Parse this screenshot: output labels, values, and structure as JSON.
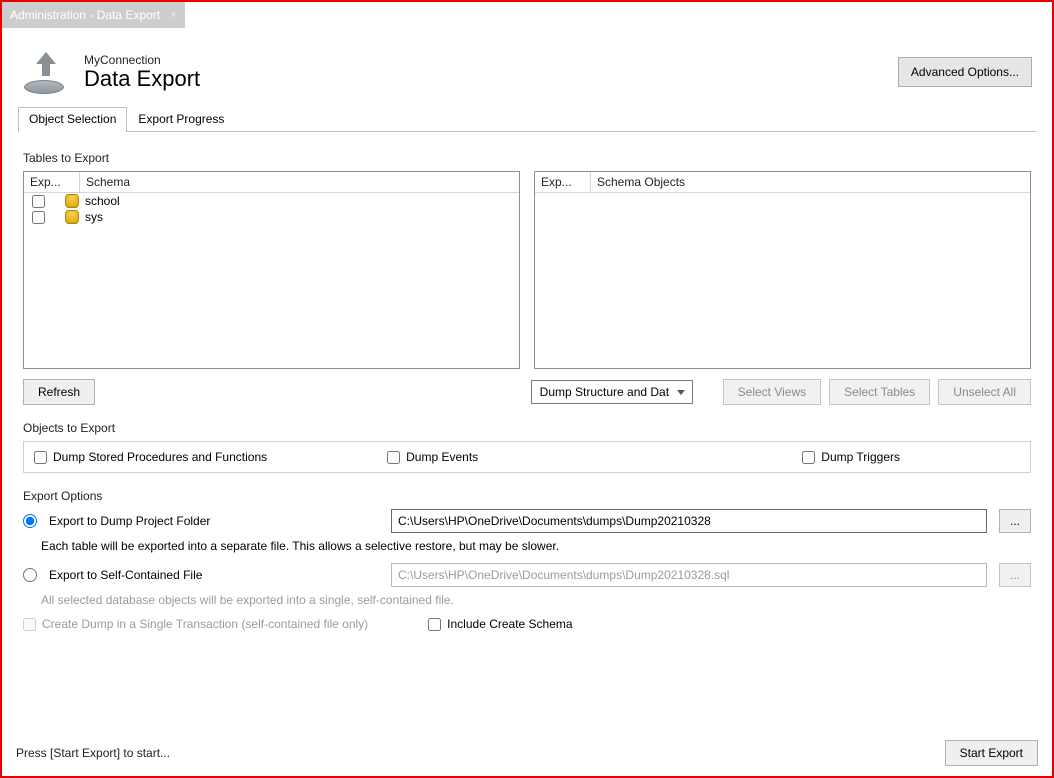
{
  "document_tab": {
    "title": "Administration - Data Export"
  },
  "header": {
    "connection": "MyConnection",
    "title": "Data Export",
    "advanced_button": "Advanced Options..."
  },
  "tabs": {
    "object_selection": "Object Selection",
    "export_progress": "Export Progress"
  },
  "tables_section": {
    "label": "Tables to Export",
    "left": {
      "col_export": "Exp...",
      "col_schema": "Schema",
      "rows": [
        {
          "name": "school"
        },
        {
          "name": "sys"
        }
      ]
    },
    "right": {
      "col_export": "Exp...",
      "col_objects": "Schema Objects"
    },
    "refresh": "Refresh",
    "dump_select": "Dump Structure and Dat",
    "select_views": "Select Views",
    "select_tables": "Select Tables",
    "unselect_all": "Unselect All"
  },
  "objects_section": {
    "label": "Objects to Export",
    "procs": "Dump Stored Procedures and Functions",
    "events": "Dump Events",
    "triggers": "Dump Triggers"
  },
  "export_options": {
    "label": "Export Options",
    "radio_folder": "Export to Dump Project Folder",
    "folder_path": "C:\\Users\\HP\\OneDrive\\Documents\\dumps\\Dump20210328",
    "folder_hint": "Each table will be exported into a separate file. This allows a selective restore, but may be slower.",
    "radio_file": "Export to Self-Contained File",
    "file_path": "C:\\Users\\HP\\OneDrive\\Documents\\dumps\\Dump20210328.sql",
    "file_hint": "All selected database objects will be exported into a single, self-contained file.",
    "single_txn": "Create Dump in a Single Transaction (self-contained file only)",
    "include_create": "Include Create Schema",
    "browse": "..."
  },
  "footer": {
    "status": "Press [Start Export] to start...",
    "start_export": "Start Export"
  }
}
